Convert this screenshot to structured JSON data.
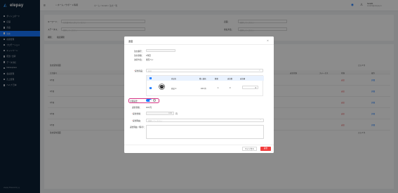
{
  "sidebar": {
    "logo": "elepay",
    "items": [
      {
        "label": "ダッシュボード",
        "active": false
      },
      {
        "label": "店舗",
        "active": false
      },
      {
        "label": "商品",
        "active": false
      },
      {
        "label": "注文",
        "active": true
      },
      {
        "label": "在庫管理",
        "active": false
      },
      {
        "label": "プロモーション",
        "active": false
      },
      {
        "label": "キャンペーン",
        "active": false
      },
      {
        "label": "配送 / 出荷",
        "active": false
      },
      {
        "label": "データ分析",
        "active": false
      },
      {
        "label": "Marketplace",
        "active": false
      },
      {
        "label": "会員管理",
        "active": false
      },
      {
        "label": "売上管理",
        "active": false
      },
      {
        "label": "ヘルプ 日本",
        "active": false
      }
    ],
    "footer": "elepay  Powered by ◎"
  },
  "topbar": {
    "menu_icon": "≡",
    "home_label": "⌂  ホーム / サポート情報",
    "breadcrumb": "ホーム / Sora01 / 注文一覧",
    "user_name": "Sora01",
    "user_sub": "sora01@elepay.io"
  },
  "filters": {
    "order_no_label": "キーワード：",
    "order_no_placeholder": "注文番号を入力してください",
    "status_label": "ステータス：",
    "status_placeholder": "選択してください",
    "period_label": "期間：",
    "period_value": "指定期間",
    "right1_label": "店舗：",
    "right1_placeholder": "選択してください",
    "right2_label": "支払方法：",
    "right2_placeholder": "選択してください",
    "search_button": "検索",
    "export_button": "CSV Export"
  },
  "list": {
    "title": "注文受付画面",
    "columns": [
      "注文番号",
      "金額",
      "返金状態",
      "ステータス",
      "状態",
      "操作"
    ],
    "rows": [
      {
        "no": "1件目",
        "status": "返金",
        "action": "詳細"
      },
      {
        "no": "1件目",
        "status": "返金",
        "action": "詳細"
      },
      {
        "no": "1件目",
        "status": "返金",
        "action": "詳細"
      },
      {
        "no": "1件目",
        "status": "返金",
        "action": "詳細"
      },
      {
        "no": "1件目",
        "status": "返金",
        "action": "詳細"
      }
    ],
    "footer_left": "注文受付画面",
    "pagination": "合計 5 件"
  },
  "modal": {
    "title": "返金",
    "close_icon": "✕",
    "order_no_label": "注文番号：",
    "order_no_value": "",
    "order_amount_label": "注文金額：",
    "order_amount_value": "1件目",
    "payment_label": "決済方法：",
    "payment_value": "楽天ペイ",
    "product_label": "返金商品：",
    "product_placeholder": "商品",
    "table": {
      "headers": [
        "商品名",
        "購入価格",
        "数量",
        "返金数",
        "返金額"
      ],
      "row": {
        "name": "商品 2",
        "price": "100 円",
        "qty": "1",
        "refund_qty": "0",
        "refund_amount": "0"
      }
    },
    "all_refund_label": "全額返金：",
    "all_refund_on": true,
    "refund_amount_label": "返金金額：",
    "refund_amount_value": "100 円",
    "fee_label": "返金金額：",
    "fee_value": "0.00",
    "fee_unit": "円",
    "reason_label": "返金理由：",
    "reason_placeholder": "選択してください",
    "memo_label": "返金理由（備考）：",
    "cancel_button": "キャンセル",
    "ok_button": "返金"
  }
}
